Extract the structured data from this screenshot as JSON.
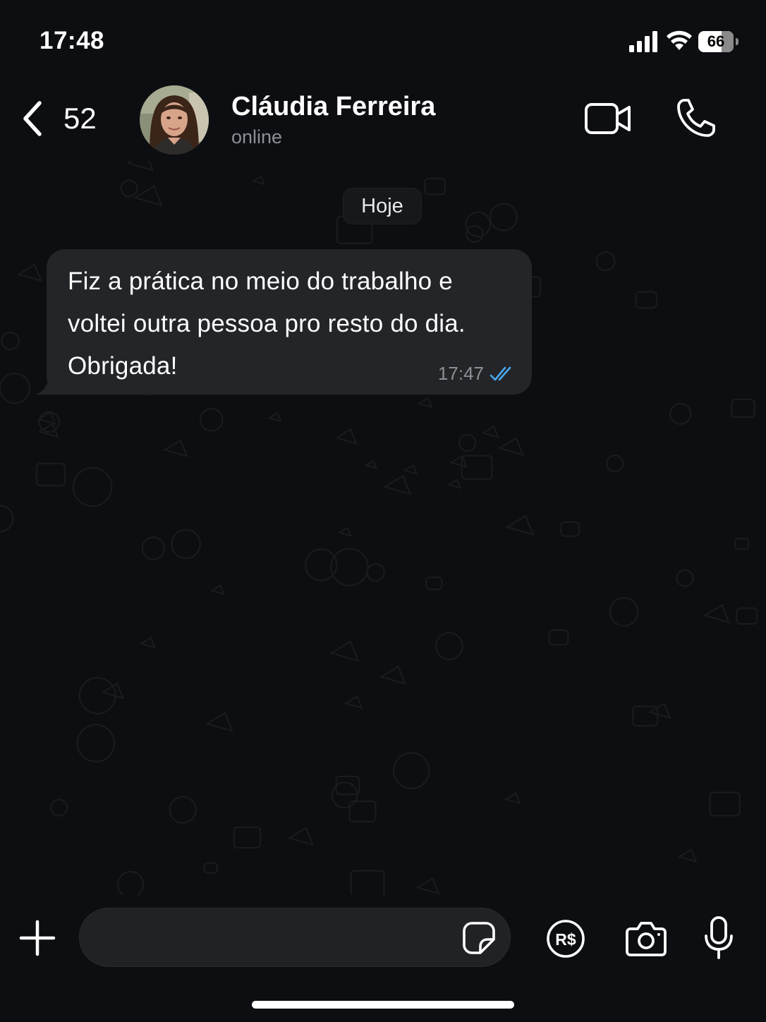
{
  "status_bar": {
    "time": "17:48",
    "battery_level": "66",
    "battery_fraction": 0.66,
    "signal_icon": "cellular-signal-icon",
    "wifi_icon": "wifi-icon",
    "battery_icon": "battery-icon"
  },
  "header": {
    "back_icon": "chevron-left-icon",
    "back_count": "52",
    "contact_name": "Cláudia Ferreira",
    "contact_status": "online",
    "video_icon": "video-camera-icon",
    "call_icon": "phone-icon"
  },
  "chat": {
    "date_label": "Hoje",
    "messages": [
      {
        "direction": "incoming",
        "text_lines": [
          "Fiz a prática no meio do trabalho e",
          "voltei outra pessoa pro resto do dia.",
          "Obrigada!"
        ],
        "time": "17:47",
        "status_icon": "double-check-icon"
      }
    ]
  },
  "input_bar": {
    "attach_icon": "plus-icon",
    "input_value": "",
    "sticker_icon": "sticker-icon",
    "payment_icon": "payment-real-icon",
    "payment_label": "R$",
    "camera_icon": "camera-icon",
    "mic_icon": "microphone-icon"
  },
  "colors": {
    "background": "#0c0e11",
    "bubble": "#232528",
    "secondary_text": "#8c8f94",
    "read_check": "#4aa8f0",
    "input_field": "#202225"
  }
}
